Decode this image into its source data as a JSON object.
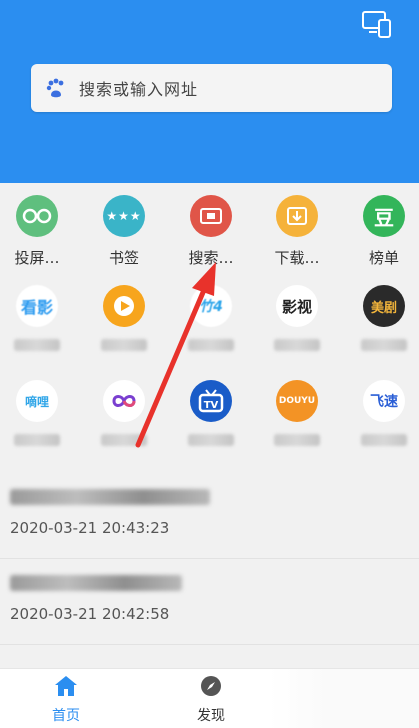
{
  "search": {
    "placeholder": "搜索或输入网址"
  },
  "tools": [
    {
      "label": "投屏…",
      "icon": "cast-glasses-icon",
      "color": "#5fbf7e"
    },
    {
      "label": "书签",
      "icon": "bookmark-stars-icon",
      "color": "#3ab4c8"
    },
    {
      "label": "搜索…",
      "icon": "search-screen-icon",
      "color": "#e05548"
    },
    {
      "label": "下载…",
      "icon": "download-icon",
      "color": "#f5b23a"
    },
    {
      "label": "榜单",
      "icon": "rank-dou-icon",
      "color": "#33b55a"
    }
  ],
  "sites_row1": [
    {
      "icon": "kanying-logo-icon",
      "color": "#2f9cf0"
    },
    {
      "icon": "play-logo-icon",
      "color": "#f7a51d"
    },
    {
      "icon": "site-logo-icon",
      "color": "#2aa4ea"
    },
    {
      "icon": "yingshi-logo-icon",
      "color": "#222222"
    },
    {
      "icon": "meiju-logo-icon",
      "color": "#f3b53b"
    }
  ],
  "sites_row2": [
    {
      "icon": "dili-logo-icon",
      "color": "#31a6e8"
    },
    {
      "icon": "infinity-logo-icon",
      "color": "#7a3fd0"
    },
    {
      "icon": "tv-logo-icon",
      "color": "#1a5cc8"
    },
    {
      "icon": "douyu-logo-icon",
      "color": "#f39325"
    },
    {
      "icon": "feisu-logo-icon",
      "color": "#2b5fd6"
    }
  ],
  "history": [
    {
      "time": "2020-03-21 20:43:23"
    },
    {
      "time": "2020-03-21 20:42:58"
    }
  ],
  "nav": {
    "home": "首页",
    "discover": "发现"
  },
  "colors": {
    "brand": "#2b8ef0",
    "annotation": "#e8322b"
  }
}
